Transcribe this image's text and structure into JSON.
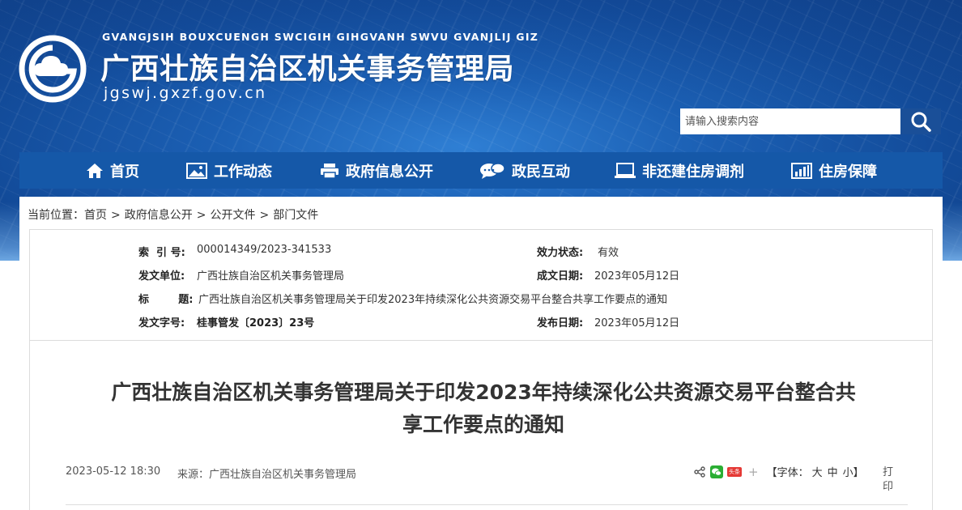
{
  "header": {
    "pinyin": "GVANGJSIH BOUXCUENGH SWCIGIH GIHGVANH SWVU GVANJLIJ GIZ",
    "title": "广西壮族自治区机关事务管理局",
    "domain": "jgswj.gxzf.gov.cn"
  },
  "search": {
    "placeholder": "请输入搜索内容",
    "icon": "search-icon"
  },
  "nav": {
    "items": [
      {
        "label": "首页",
        "icon": "home-icon"
      },
      {
        "label": "工作动态",
        "icon": "image-icon"
      },
      {
        "label": "政府信息公开",
        "icon": "printer-icon"
      },
      {
        "label": "政民互动",
        "icon": "chat-icon"
      },
      {
        "label": "非还建住房调剂",
        "icon": "monitor-icon"
      },
      {
        "label": "住房保障",
        "icon": "bar-chart-icon"
      }
    ]
  },
  "breadcrumb": {
    "prefix": "当前位置：",
    "items": [
      "首页",
      "政府信息公开",
      "公开文件",
      "部门文件"
    ],
    "separator": ">"
  },
  "meta": {
    "index_label": "索  引 号:",
    "index_value": "000014349/2023-341533",
    "validity_label": "效力状态:",
    "validity_value": "有效",
    "issuer_label": "发文单位:",
    "issuer_value": "广西壮族自治区机关事务管理局",
    "created_label": "成文日期:",
    "created_value": "2023年05月12日",
    "title_label": "标        题:",
    "title_value": "广西壮族自治区机关事务管理局关于印发2023年持续深化公共资源交易平台整合共享工作要点的通知",
    "docno_label": "发文字号:",
    "docno_value": "桂事管发〔2023〕23号",
    "published_label": "发布日期:",
    "published_value": "2023年05月12日"
  },
  "article": {
    "title_line1": "广西壮族自治区机关事务管理局关于印发2023年持续深化公共资源交易平台整合共",
    "title_line2": "享工作要点的通知",
    "datetime": "2023-05-12 18:30",
    "source": "来源：广西壮族自治区机关事务管理局",
    "font_label": "【字体：",
    "font_large": "大",
    "font_medium": "中",
    "font_small": "小",
    "font_close": "】",
    "print": "打印",
    "toutiao": "头条",
    "plus": "+"
  }
}
